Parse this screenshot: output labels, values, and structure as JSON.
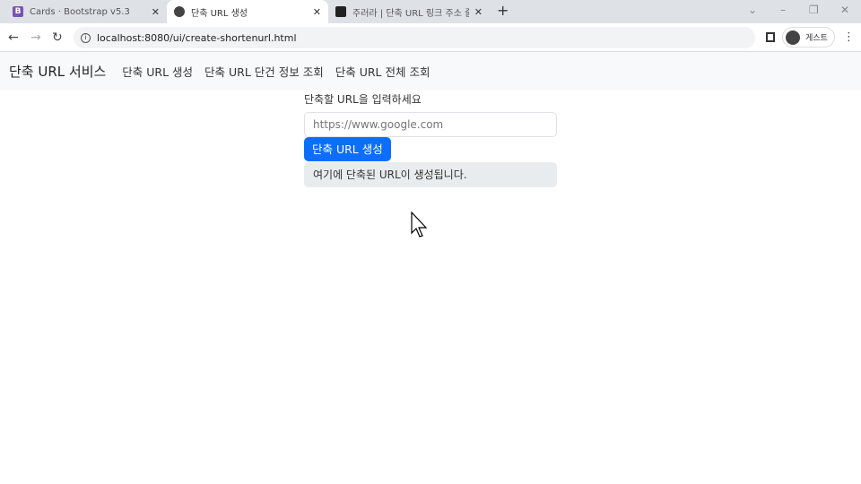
{
  "browser": {
    "tabs": [
      {
        "label": "Cards · Bootstrap v5.3",
        "icon": "bootstrap-icon",
        "icon_text": "B",
        "color": "#7952b3"
      },
      {
        "label": "단축 URL 생성",
        "icon": "globe-icon",
        "active": true
      },
      {
        "label": "주러라 | 단축 URL 링크 주소 줄이기",
        "icon": "site-icon",
        "color": "#222222"
      }
    ],
    "url": "localhost:8080/ui/create-shortenurl.html",
    "profile_label": "게스트"
  },
  "navbar": {
    "brand": "단축 URL 서비스",
    "links": [
      "단축 URL 생성",
      "단축 URL 단건 정보 조회",
      "단축 URL 전체 조회"
    ]
  },
  "form": {
    "label": "단축할 URL을 입력하세요",
    "placeholder": "https://www.google.com",
    "value": "",
    "submit_label": "단축 URL 생성",
    "result_text": "여기에 단축된 URL이 생성됩니다."
  },
  "colors": {
    "primary": "#0d6efd"
  }
}
